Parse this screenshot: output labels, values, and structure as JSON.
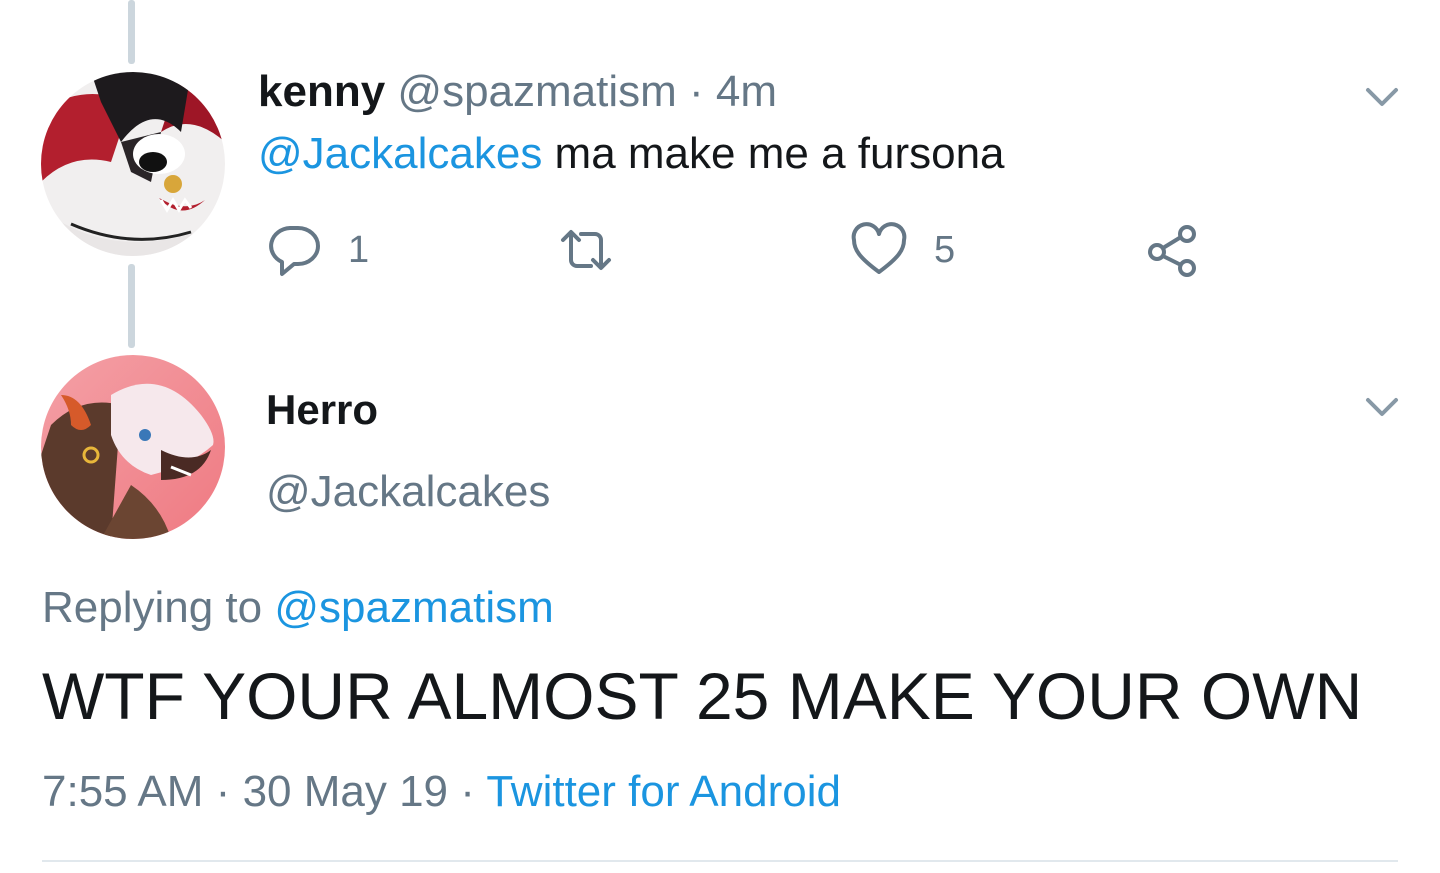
{
  "reply": {
    "name": "kenny",
    "handle": "@spazmatism",
    "separator": "·",
    "time": "4m",
    "mention": "@Jackalcakes",
    "text": " ma make me a fursona",
    "actions": {
      "reply_icon": "comment-icon",
      "reply_count": "1",
      "retweet_icon": "retweet-icon",
      "like_icon": "heart-icon",
      "like_count": "5",
      "share_icon": "share-icon"
    }
  },
  "main_tweet": {
    "name": "Herro",
    "handle": "@Jackalcakes",
    "replying_prefix": "Replying to ",
    "replying_to": "@spazmatism",
    "text": "WTF YOUR ALMOST 25 MAKE YOUR OWN",
    "time": "7:55 AM",
    "separator": "·",
    "date": "30 May 19",
    "separator2": "·",
    "source": "Twitter for Android"
  },
  "colors": {
    "link": "#1b95e0",
    "muted": "#657786",
    "text": "#14171a",
    "thread_line": "#ccd6dd"
  }
}
